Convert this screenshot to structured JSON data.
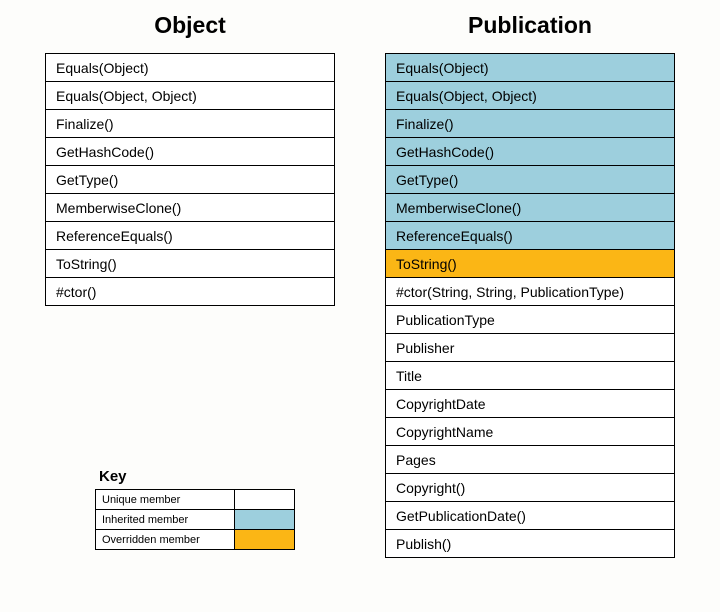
{
  "headings": {
    "object": "Object",
    "publication": "Publication"
  },
  "object_members": [
    {
      "name": "Equals(Object)",
      "kind": "unique"
    },
    {
      "name": "Equals(Object, Object)",
      "kind": "unique"
    },
    {
      "name": "Finalize()",
      "kind": "unique"
    },
    {
      "name": "GetHashCode()",
      "kind": "unique"
    },
    {
      "name": "GetType()",
      "kind": "unique"
    },
    {
      "name": "MemberwiseClone()",
      "kind": "unique"
    },
    {
      "name": "ReferenceEquals()",
      "kind": "unique"
    },
    {
      "name": "ToString()",
      "kind": "unique"
    },
    {
      "name": "#ctor()",
      "kind": "unique"
    }
  ],
  "publication_members": [
    {
      "name": "Equals(Object)",
      "kind": "inherited"
    },
    {
      "name": "Equals(Object, Object)",
      "kind": "inherited"
    },
    {
      "name": "Finalize()",
      "kind": "inherited"
    },
    {
      "name": "GetHashCode()",
      "kind": "inherited"
    },
    {
      "name": "GetType()",
      "kind": "inherited"
    },
    {
      "name": "MemberwiseClone()",
      "kind": "inherited"
    },
    {
      "name": "ReferenceEquals()",
      "kind": "inherited"
    },
    {
      "name": "ToString()",
      "kind": "overridden"
    },
    {
      "name": "#ctor(String, String, PublicationType)",
      "kind": "unique"
    },
    {
      "name": "PublicationType",
      "kind": "unique"
    },
    {
      "name": "Publisher",
      "kind": "unique"
    },
    {
      "name": "Title",
      "kind": "unique"
    },
    {
      "name": "CopyrightDate",
      "kind": "unique"
    },
    {
      "name": "CopyrightName",
      "kind": "unique"
    },
    {
      "name": "Pages",
      "kind": "unique"
    },
    {
      "name": "Copyright()",
      "kind": "unique"
    },
    {
      "name": "GetPublicationDate()",
      "kind": "unique"
    },
    {
      "name": "Publish()",
      "kind": "unique"
    }
  ],
  "key": {
    "title": "Key",
    "entries": [
      {
        "label": "Unique member",
        "kind": "unique"
      },
      {
        "label": "Inherited member",
        "kind": "inherited"
      },
      {
        "label": "Overridden member",
        "kind": "overridden"
      }
    ]
  },
  "colors": {
    "inherited": "#9dcfdd",
    "overridden": "#fbb615",
    "unique": "#ffffff"
  }
}
